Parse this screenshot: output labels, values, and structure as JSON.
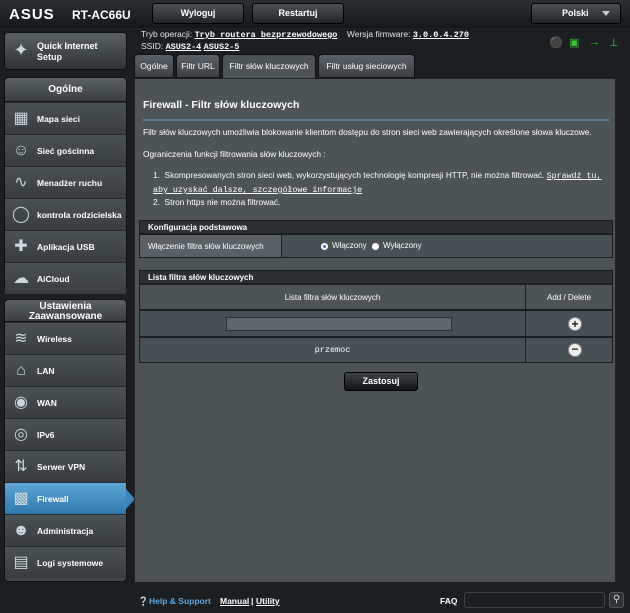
{
  "header": {
    "brand": "ASUS",
    "model": "RT-AC66U",
    "logout_label": "Wyloguj",
    "restart_label": "Restartuj",
    "language": "Polski"
  },
  "info": {
    "mode_label": "Tryb operacji:",
    "mode_value": "Tryb routera bezprzewodowego",
    "firmware_label": "Wersja firmware:",
    "firmware_value": "3.0.0.4.270",
    "ssid_label": "SSID:",
    "ssid_1": "ASUS2-4",
    "ssid_2": "ASUS2-5"
  },
  "sidebar": {
    "qis_label": "Quick Internet Setup",
    "general_title": "Ogólne",
    "general_items": [
      {
        "label": "Mapa sieci",
        "icon": "network-map-icon"
      },
      {
        "label": "Sieć gościnna",
        "icon": "guest-network-icon"
      },
      {
        "label": "Menadżer ruchu",
        "icon": "traffic-manager-icon"
      },
      {
        "label": "kontrola rodzicielska",
        "icon": "parental-control-icon"
      },
      {
        "label": "Aplikacja USB",
        "icon": "usb-app-icon"
      },
      {
        "label": "AiCloud",
        "icon": "aicloud-icon"
      }
    ],
    "advanced_title": "Ustawienia Zaawansowane",
    "advanced_items": [
      {
        "label": "Wireless",
        "icon": "wifi-icon"
      },
      {
        "label": "LAN",
        "icon": "home-icon"
      },
      {
        "label": "WAN",
        "icon": "globe-icon"
      },
      {
        "label": "IPv6",
        "icon": "ipv6-icon"
      },
      {
        "label": "Serwer VPN",
        "icon": "vpn-icon"
      },
      {
        "label": "Firewall",
        "icon": "firewall-icon"
      },
      {
        "label": "Administracja",
        "icon": "admin-icon"
      },
      {
        "label": "Logi systemowe",
        "icon": "syslog-icon"
      }
    ]
  },
  "tabs": [
    "Ogólne",
    "Filtr URL",
    "Filtr słów kluczowych",
    "Filtr usług sieciowych"
  ],
  "page": {
    "title": "Firewall - Filtr słów kluczowych",
    "intro": "Filtr słów kluczowych umożliwia blokowanie klientom dostępu do stron sieci web zawierających określone słowa kluczowe.",
    "limits_heading": "Ograniczenia funkcji filtrowania słów kluczowych :",
    "limit1_text": "Skompresowanych stron sieci web, wykorzystujących technologię kompresji HTTP, nie można filtrować.",
    "limit1_link": "Sprawdź tu, aby uzyskać dalsze, szczegółowe informacje",
    "limit2_text": "Stron https nie można filtrować.",
    "basic_header": "Konfiguracja podstawowa",
    "enable_label": "Włączenie filtra słów kluczowych",
    "radio_on": "Włączony",
    "radio_off": "Wyłączony",
    "list_header": "Lista filtra słów kluczowych",
    "col_keyword": "Lista filtra słów kluczowych",
    "col_action": "Add / Delete",
    "input_value": "",
    "keywords": [
      "przemoc"
    ],
    "apply_label": "Zastosuj"
  },
  "footer": {
    "help": "Help & Support",
    "manual": "Manual",
    "sep": "|",
    "utility": "Utility",
    "faq": "FAQ"
  }
}
